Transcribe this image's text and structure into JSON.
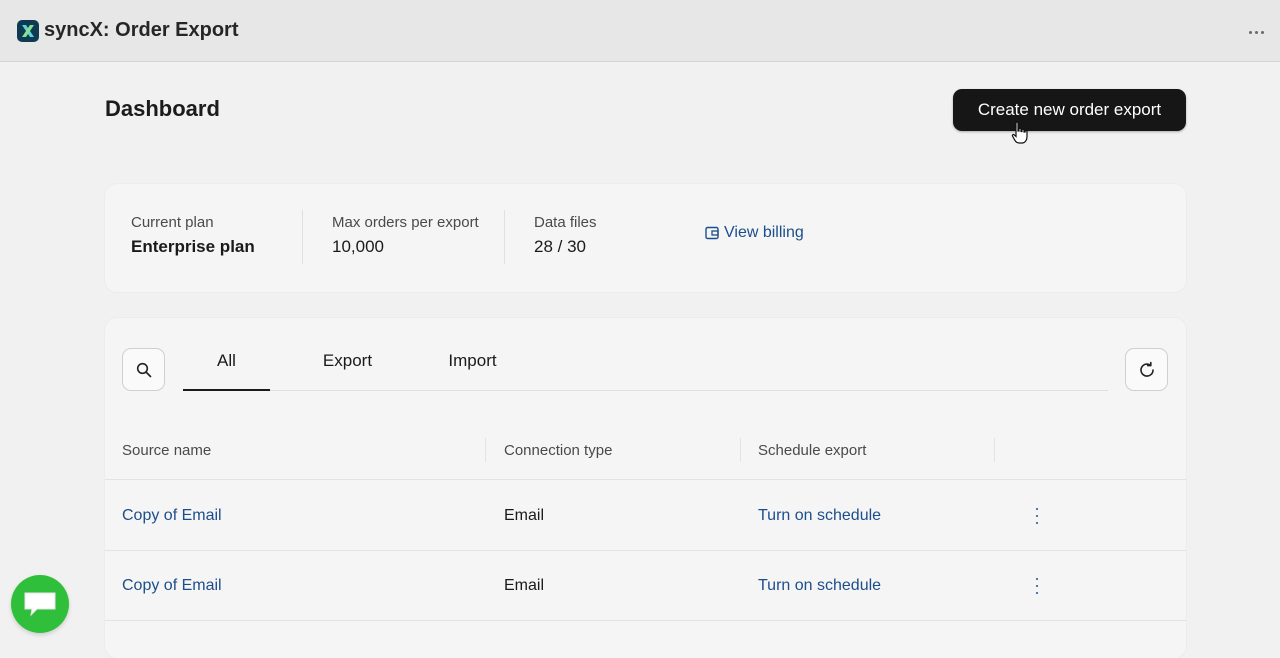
{
  "app": {
    "title": "syncX: Order Export"
  },
  "header": {
    "title": "Dashboard",
    "create_label": "Create new order export"
  },
  "plan": {
    "stats": [
      {
        "label": "Current plan",
        "value": "Enterprise plan"
      },
      {
        "label": "Max orders per export",
        "value": "10,000"
      },
      {
        "label": "Data files",
        "value": "28 / 30"
      }
    ],
    "billing_label": "View billing"
  },
  "tabs": [
    {
      "label": "All",
      "active": true
    },
    {
      "label": "Export",
      "active": false
    },
    {
      "label": "Import",
      "active": false
    }
  ],
  "table": {
    "columns": [
      "Source name",
      "Connection type",
      "Schedule export"
    ],
    "rows": [
      {
        "source": "Copy of Email",
        "connection": "Email",
        "schedule": "Turn on schedule"
      },
      {
        "source": "Copy of Email",
        "connection": "Email",
        "schedule": "Turn on schedule"
      }
    ]
  },
  "colors": {
    "accent": "#1d4e8c",
    "primary_button": "#161616",
    "chat": "#2fbf3b",
    "logo": "#0f3b52"
  }
}
